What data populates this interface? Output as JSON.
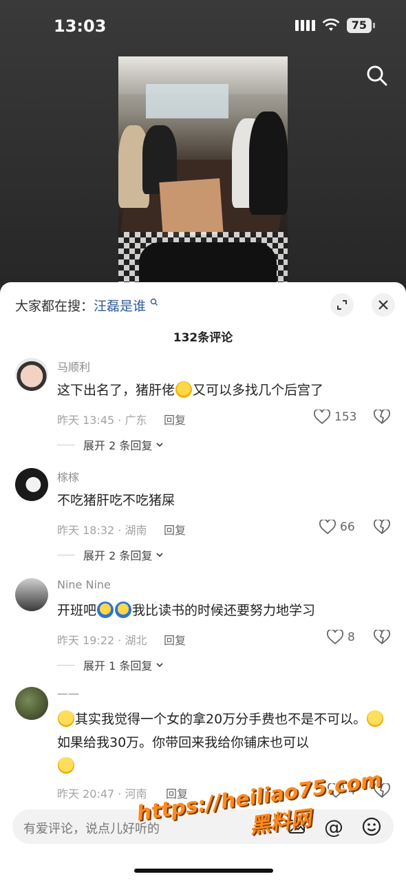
{
  "status_bar": {
    "time": "13:03",
    "battery": "75"
  },
  "sheet": {
    "trending_prefix": "大家都在搜：",
    "trending_keyword": "汪磊是谁",
    "comment_count_label": "132条评论"
  },
  "comments": [
    {
      "username": "马顺利",
      "text_parts": [
        "这下出名了，猪肝佬",
        "又可以多找几个后宫了"
      ],
      "meta": "昨天 13:45 · 广东",
      "reply_label": "回复",
      "likes": "153",
      "expand_label": "展开 2 条回复"
    },
    {
      "username": "榢榢",
      "text": "不吃猪肝吃不吃猪屎",
      "meta": "昨天 18:32 · 湖南",
      "reply_label": "回复",
      "likes": "66",
      "expand_label": "展开 2 条回复"
    },
    {
      "username": "Nine Nine",
      "text_parts": [
        "开班吧",
        "我比读书的时候还要努力地学习"
      ],
      "meta": "昨天 19:22 · 湖北",
      "reply_label": "回复",
      "likes": "8",
      "expand_label": "展开 1 条回复"
    },
    {
      "username": "——",
      "text_parts": [
        "其实我觉得一个女的拿20万分手费也不是不可以。",
        " 如果给我30万。你带回来我给你铺床也可以"
      ],
      "meta": "昨天 20:47 · 河南",
      "reply_label": "回复",
      "likes": "4"
    }
  ],
  "input": {
    "placeholder": "有爱评论，说点儿好听的"
  },
  "watermark": {
    "url": "https://heiliao75.com",
    "name": "黑料网"
  },
  "icons": [
    "search-icon",
    "expand-icon",
    "close-icon",
    "heart-icon",
    "dislike-heart-icon",
    "chevron-down-icon",
    "image-icon",
    "at-icon",
    "emoji-icon",
    "wifi-icon",
    "signal-icon"
  ]
}
